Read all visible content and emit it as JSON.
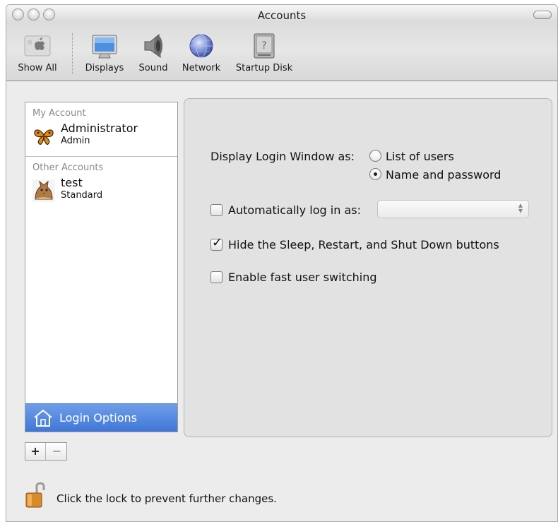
{
  "window": {
    "title": "Accounts"
  },
  "toolbar": {
    "items": [
      {
        "label": "Show All",
        "icon": "apple-logo-icon"
      },
      {
        "label": "Displays",
        "icon": "display-icon"
      },
      {
        "label": "Sound",
        "icon": "speaker-icon"
      },
      {
        "label": "Network",
        "icon": "globe-icon"
      },
      {
        "label": "Startup Disk",
        "icon": "disk-icon"
      }
    ]
  },
  "sidebar": {
    "my_account_title": "My Account",
    "my_account": {
      "name": "Administrator",
      "role": "Admin",
      "icon": "butterfly-avatar-icon"
    },
    "other_accounts_title": "Other Accounts",
    "other_accounts": [
      {
        "name": "test",
        "role": "Standard",
        "icon": "cat-avatar-icon"
      }
    ],
    "login_options_label": "Login Options"
  },
  "buttons": {
    "add": "+",
    "remove": "−"
  },
  "login_options": {
    "display_login_label": "Display Login Window as:",
    "radio_list_users": "List of users",
    "radio_name_password": "Name and password",
    "selected": "Name and password",
    "auto_login_label": "Automatically log in as:",
    "auto_login_checked": false,
    "auto_login_value": "",
    "hide_buttons_label": "Hide the Sleep, Restart, and Shut Down buttons",
    "hide_buttons_checked": true,
    "fast_switch_label": "Enable fast user switching",
    "fast_switch_checked": false
  },
  "lock": {
    "text": "Click the lock to prevent further changes.",
    "icon": "open-lock-icon"
  },
  "colors": {
    "selection": "#3f76d8",
    "panel": "#e2e2e2",
    "window": "#ececec"
  }
}
